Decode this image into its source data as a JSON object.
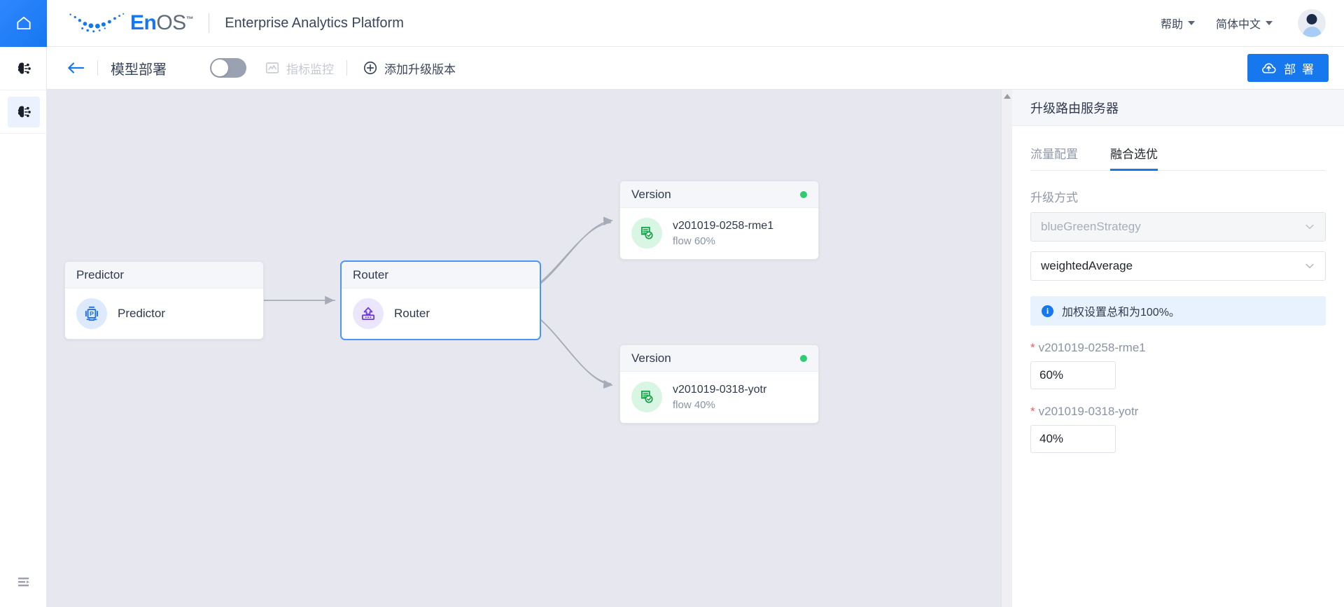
{
  "header": {
    "home_icon": "home-icon",
    "brand_en": "En",
    "brand_os": "OS",
    "brand_tm": "™",
    "app_title": "Enterprise Analytics Platform",
    "help_label": "帮助",
    "language_label": "简体中文",
    "avatar_name": "user-avatar"
  },
  "rail": {
    "items": [
      {
        "name": "model-icon",
        "label": "模型",
        "active": false
      },
      {
        "name": "deployment-icon",
        "label": "部署",
        "active": true
      }
    ],
    "collapse_label": "collapse-menu-icon"
  },
  "toolbar": {
    "back_label": "返回",
    "page_title": "模型部署",
    "toggle_state": "off",
    "monitor_label": "指标监控",
    "monitor_disabled": true,
    "add_version_label": "添加升级版本",
    "deploy_label": "部 署"
  },
  "canvas": {
    "nodes": [
      {
        "id": "predictor",
        "header": "Predictor",
        "label": "Predictor",
        "icon": "predictor-icon",
        "icon_color": "#1f6fe0",
        "selected": false,
        "has_status_dot": false
      },
      {
        "id": "router",
        "header": "Router",
        "label": "Router",
        "icon": "router-icon",
        "icon_color": "#6c3fe0",
        "selected": true,
        "has_status_dot": false
      },
      {
        "id": "version-top",
        "header": "Version",
        "title": "v201019-0258-rme1",
        "flow": "flow 60%",
        "icon": "version-check-icon",
        "icon_color": "#16a34a",
        "selected": false,
        "has_status_dot": true,
        "status_color": "#2ecb71"
      },
      {
        "id": "version-bottom",
        "header": "Version",
        "title": "v201019-0318-yotr",
        "flow": "flow 40%",
        "icon": "version-check-icon",
        "icon_color": "#16a34a",
        "selected": false,
        "has_status_dot": true,
        "status_color": "#2ecb71"
      }
    ],
    "background": "#e7e8ef",
    "edge_color": "#a6abb8"
  },
  "panel": {
    "title": "升级路由服务器",
    "tabs": [
      {
        "label": "流量配置",
        "active": false
      },
      {
        "label": "融合选优",
        "active": true
      }
    ],
    "upgrade_method_label": "升级方式",
    "strategy_value": "blueGreenStrategy",
    "strategy_disabled": true,
    "fusion_value": "weightedAverage",
    "fusion_disabled": false,
    "info_text": "加权设置总和为100%。",
    "weights": [
      {
        "label": "v201019-0258-rme1",
        "value": "60%",
        "required": true
      },
      {
        "label": "v201019-0318-yotr",
        "value": "40%",
        "required": true
      }
    ]
  },
  "colors": {
    "accent": "#1677ef",
    "canvas_bg": "#e7e8ef",
    "green": "#2ecb71",
    "required_red": "#f45b5b"
  }
}
